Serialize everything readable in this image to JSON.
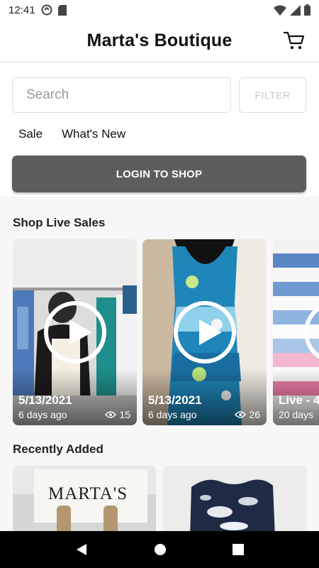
{
  "status_bar": {
    "time": "12:41"
  },
  "header": {
    "title": "Marta's Boutique"
  },
  "search": {
    "placeholder": "Search",
    "filter_label": "FILTER"
  },
  "categories": [
    "Sale",
    "What's New"
  ],
  "login_button": "LOGIN TO SHOP",
  "live_sales": {
    "title": "Shop Live Sales",
    "items": [
      {
        "date": "5/13/2021",
        "ago": "6 days ago",
        "views": "15"
      },
      {
        "date": "5/13/2021",
        "ago": "6 days ago",
        "views": "26"
      },
      {
        "date": "Live - 4",
        "ago": "20 days"
      }
    ]
  },
  "recently_added": {
    "title": "Recently Added",
    "items": [
      {
        "sign_text": "MARTA'S"
      }
    ]
  },
  "colors": {
    "primary_button": "#5d5d5d",
    "background": "#f7f7f7"
  }
}
